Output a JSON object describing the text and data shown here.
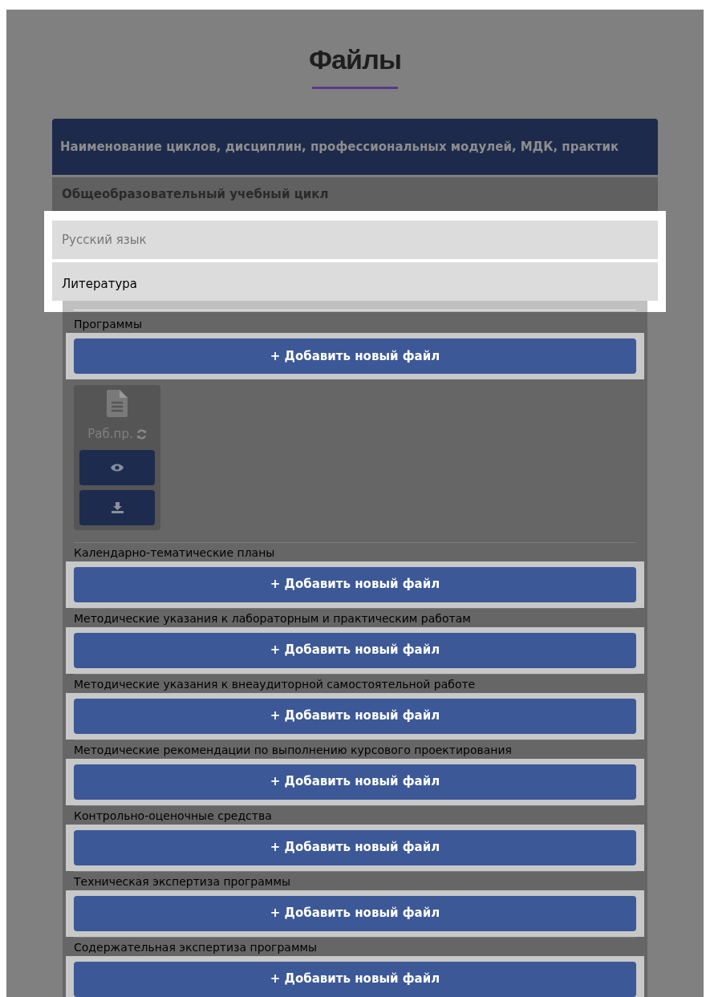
{
  "title": "Файлы",
  "table": {
    "header": "Наименование циклов, дисциплин, профессиональных модулей, МДК, практик",
    "rows": [
      {
        "label": "Общеобразовательный учебный цикл",
        "kind": "group"
      },
      {
        "label": "Русский язык",
        "kind": "item",
        "expanded": false
      },
      {
        "label": "Литература",
        "kind": "item",
        "expanded": true
      }
    ]
  },
  "sections": [
    {
      "title": "Программы",
      "button": "+ Добавить новый файл",
      "files": [
        {
          "name": "Раб.пр."
        }
      ]
    },
    {
      "title": "Календарно-тематические планы",
      "button": "+ Добавить новый файл"
    },
    {
      "title": "Методические указания к лабораторным и практическим работам",
      "button": "+ Добавить новый файл"
    },
    {
      "title": "Методические указания к внеаудиторной самостоятельной работе",
      "button": "+ Добавить новый файл"
    },
    {
      "title": "Методические рекомендации по выполнению курсового проектирования",
      "button": "+ Добавить новый файл"
    },
    {
      "title": "Контрольно-оценочные средства",
      "button": "+ Добавить новый файл"
    },
    {
      "title": "Техническая экспертиза программы",
      "button": "+ Добавить новый файл"
    },
    {
      "title": "Содержательная экспертиза программы",
      "button": "+ Добавить новый файл"
    }
  ]
}
